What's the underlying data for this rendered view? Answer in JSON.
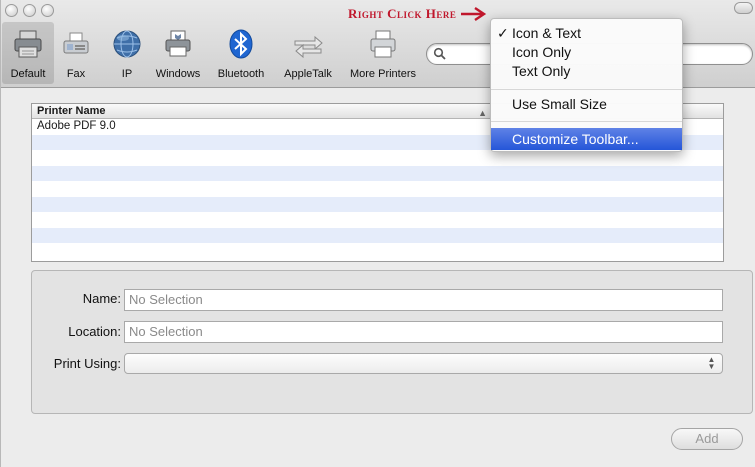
{
  "annotation": {
    "text": "Right Click Here",
    "color": "#c0172c"
  },
  "toolbar": {
    "items": [
      {
        "label": "Default",
        "icon": "printer-icon"
      },
      {
        "label": "Fax",
        "icon": "fax-icon"
      },
      {
        "label": "IP",
        "icon": "globe-icon"
      },
      {
        "label": "Windows",
        "icon": "windows-printer-icon"
      },
      {
        "label": "Bluetooth",
        "icon": "bluetooth-icon"
      },
      {
        "label": "AppleTalk",
        "icon": "appletalk-icon"
      },
      {
        "label": "More Printers",
        "icon": "printer-icon"
      }
    ],
    "search": {
      "placeholder": "",
      "icon": "search-icon"
    }
  },
  "table": {
    "header": "Printer Name",
    "sort_indicator": "▲",
    "rows": [
      "Adobe PDF 9.0",
      "",
      "",
      "",
      "",
      "",
      "",
      "",
      ""
    ]
  },
  "details": {
    "name_label": "Name:",
    "name_value": "No Selection",
    "location_label": "Location:",
    "location_value": "No Selection",
    "print_using_label": "Print Using:",
    "print_using_value": ""
  },
  "add_button": "Add",
  "context_menu": {
    "items": [
      {
        "label": "Icon & Text",
        "checked": true
      },
      {
        "label": "Icon Only",
        "checked": false
      },
      {
        "label": "Text Only",
        "checked": false
      },
      {
        "label": "Use Small Size",
        "checked": false
      },
      {
        "label": "Customize Toolbar...",
        "highlighted": true
      }
    ],
    "check_glyph": "✓",
    "highlight_color": "#2e5fdc"
  }
}
